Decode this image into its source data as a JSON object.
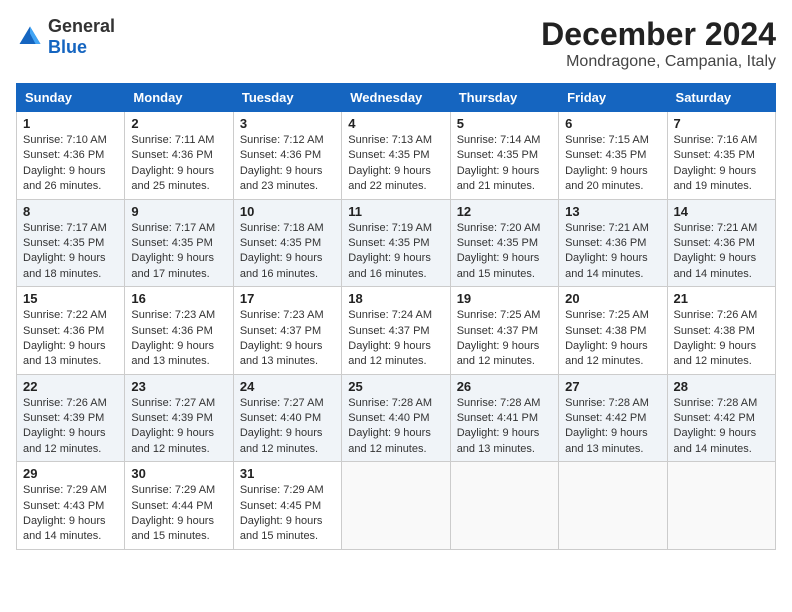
{
  "logo": {
    "text_general": "General",
    "text_blue": "Blue"
  },
  "title": "December 2024",
  "subtitle": "Mondragone, Campania, Italy",
  "days_of_week": [
    "Sunday",
    "Monday",
    "Tuesday",
    "Wednesday",
    "Thursday",
    "Friday",
    "Saturday"
  ],
  "weeks": [
    [
      {
        "day": "1",
        "sunrise": "7:10 AM",
        "sunset": "4:36 PM",
        "daylight": "9 hours and 26 minutes."
      },
      {
        "day": "2",
        "sunrise": "7:11 AM",
        "sunset": "4:36 PM",
        "daylight": "9 hours and 25 minutes."
      },
      {
        "day": "3",
        "sunrise": "7:12 AM",
        "sunset": "4:36 PM",
        "daylight": "9 hours and 23 minutes."
      },
      {
        "day": "4",
        "sunrise": "7:13 AM",
        "sunset": "4:35 PM",
        "daylight": "9 hours and 22 minutes."
      },
      {
        "day": "5",
        "sunrise": "7:14 AM",
        "sunset": "4:35 PM",
        "daylight": "9 hours and 21 minutes."
      },
      {
        "day": "6",
        "sunrise": "7:15 AM",
        "sunset": "4:35 PM",
        "daylight": "9 hours and 20 minutes."
      },
      {
        "day": "7",
        "sunrise": "7:16 AM",
        "sunset": "4:35 PM",
        "daylight": "9 hours and 19 minutes."
      }
    ],
    [
      {
        "day": "8",
        "sunrise": "7:17 AM",
        "sunset": "4:35 PM",
        "daylight": "9 hours and 18 minutes."
      },
      {
        "day": "9",
        "sunrise": "7:17 AM",
        "sunset": "4:35 PM",
        "daylight": "9 hours and 17 minutes."
      },
      {
        "day": "10",
        "sunrise": "7:18 AM",
        "sunset": "4:35 PM",
        "daylight": "9 hours and 16 minutes."
      },
      {
        "day": "11",
        "sunrise": "7:19 AM",
        "sunset": "4:35 PM",
        "daylight": "9 hours and 16 minutes."
      },
      {
        "day": "12",
        "sunrise": "7:20 AM",
        "sunset": "4:35 PM",
        "daylight": "9 hours and 15 minutes."
      },
      {
        "day": "13",
        "sunrise": "7:21 AM",
        "sunset": "4:36 PM",
        "daylight": "9 hours and 14 minutes."
      },
      {
        "day": "14",
        "sunrise": "7:21 AM",
        "sunset": "4:36 PM",
        "daylight": "9 hours and 14 minutes."
      }
    ],
    [
      {
        "day": "15",
        "sunrise": "7:22 AM",
        "sunset": "4:36 PM",
        "daylight": "9 hours and 13 minutes."
      },
      {
        "day": "16",
        "sunrise": "7:23 AM",
        "sunset": "4:36 PM",
        "daylight": "9 hours and 13 minutes."
      },
      {
        "day": "17",
        "sunrise": "7:23 AM",
        "sunset": "4:37 PM",
        "daylight": "9 hours and 13 minutes."
      },
      {
        "day": "18",
        "sunrise": "7:24 AM",
        "sunset": "4:37 PM",
        "daylight": "9 hours and 12 minutes."
      },
      {
        "day": "19",
        "sunrise": "7:25 AM",
        "sunset": "4:37 PM",
        "daylight": "9 hours and 12 minutes."
      },
      {
        "day": "20",
        "sunrise": "7:25 AM",
        "sunset": "4:38 PM",
        "daylight": "9 hours and 12 minutes."
      },
      {
        "day": "21",
        "sunrise": "7:26 AM",
        "sunset": "4:38 PM",
        "daylight": "9 hours and 12 minutes."
      }
    ],
    [
      {
        "day": "22",
        "sunrise": "7:26 AM",
        "sunset": "4:39 PM",
        "daylight": "9 hours and 12 minutes."
      },
      {
        "day": "23",
        "sunrise": "7:27 AM",
        "sunset": "4:39 PM",
        "daylight": "9 hours and 12 minutes."
      },
      {
        "day": "24",
        "sunrise": "7:27 AM",
        "sunset": "4:40 PM",
        "daylight": "9 hours and 12 minutes."
      },
      {
        "day": "25",
        "sunrise": "7:28 AM",
        "sunset": "4:40 PM",
        "daylight": "9 hours and 12 minutes."
      },
      {
        "day": "26",
        "sunrise": "7:28 AM",
        "sunset": "4:41 PM",
        "daylight": "9 hours and 13 minutes."
      },
      {
        "day": "27",
        "sunrise": "7:28 AM",
        "sunset": "4:42 PM",
        "daylight": "9 hours and 13 minutes."
      },
      {
        "day": "28",
        "sunrise": "7:28 AM",
        "sunset": "4:42 PM",
        "daylight": "9 hours and 14 minutes."
      }
    ],
    [
      {
        "day": "29",
        "sunrise": "7:29 AM",
        "sunset": "4:43 PM",
        "daylight": "9 hours and 14 minutes."
      },
      {
        "day": "30",
        "sunrise": "7:29 AM",
        "sunset": "4:44 PM",
        "daylight": "9 hours and 15 minutes."
      },
      {
        "day": "31",
        "sunrise": "7:29 AM",
        "sunset": "4:45 PM",
        "daylight": "9 hours and 15 minutes."
      },
      null,
      null,
      null,
      null
    ]
  ],
  "labels": {
    "sunrise": "Sunrise:",
    "sunset": "Sunset:",
    "daylight": "Daylight:"
  }
}
